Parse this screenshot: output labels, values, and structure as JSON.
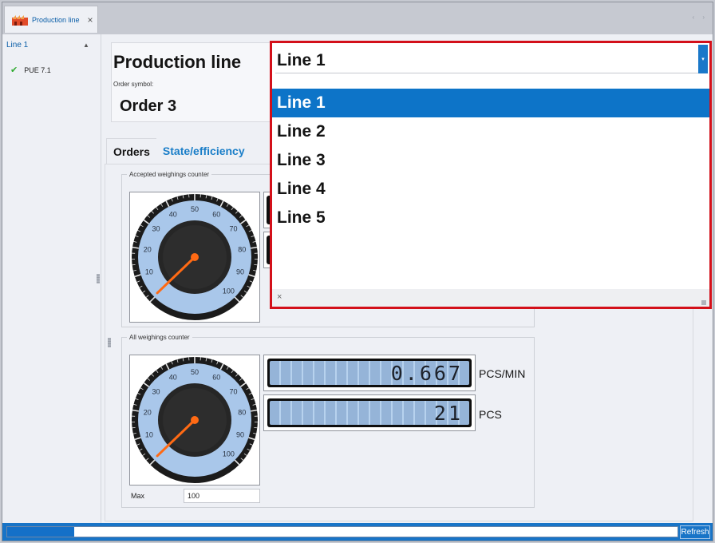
{
  "tab": {
    "label": "Production line",
    "close": "×"
  },
  "tree": {
    "root_label": "Line 1",
    "device_label": "PUE 7.1"
  },
  "header": {
    "title": "Production line",
    "order_symbol_label": "Order symbol:",
    "order_value": "Order 3"
  },
  "tabs": [
    {
      "label": "Orders"
    },
    {
      "label": "State/efficiency"
    }
  ],
  "accepted": {
    "legend": "Accepted weighings counter"
  },
  "all": {
    "legend": "All weighings counter",
    "rate_value": "0.667",
    "rate_unit": "PCS/MIN",
    "count_value": "21",
    "count_unit": "PCS",
    "max_label": "Max",
    "max_value": "100"
  },
  "gauge": {
    "scale_labels": [
      "10",
      "20",
      "30",
      "40",
      "50",
      "60",
      "70",
      "80",
      "90",
      "100"
    ],
    "needle_value": 0
  },
  "status": {
    "progress": 0.1,
    "refresh_label": "Refresh"
  },
  "dropdown": {
    "selected_value": "Line 1",
    "options": [
      "Line 1",
      "Line 2",
      "Line 3",
      "Line 4",
      "Line 5"
    ],
    "selected_index": 0,
    "close": "×"
  },
  "colors": {
    "accent": "#1874c7",
    "highlight_border": "#d3101a",
    "lcd_background": "#b7d2ee"
  }
}
